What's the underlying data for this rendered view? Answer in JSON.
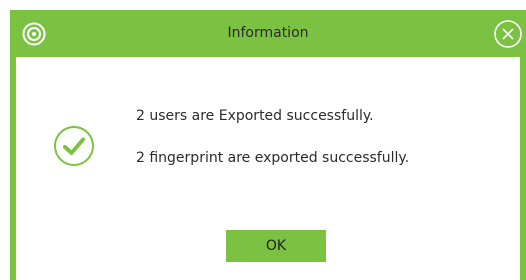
{
  "window": {
    "title": "Information",
    "app_icon": "app-logo-icon",
    "close_icon": "close-icon"
  },
  "body": {
    "status_icon": "check-circle-icon",
    "messages": [
      "2 users are Exported successfully.",
      "2 fingerprint are exported successfully."
    ]
  },
  "actions": {
    "ok_label": "OK"
  },
  "colors": {
    "accent": "#7cc242",
    "text": "#2b2b2b"
  }
}
